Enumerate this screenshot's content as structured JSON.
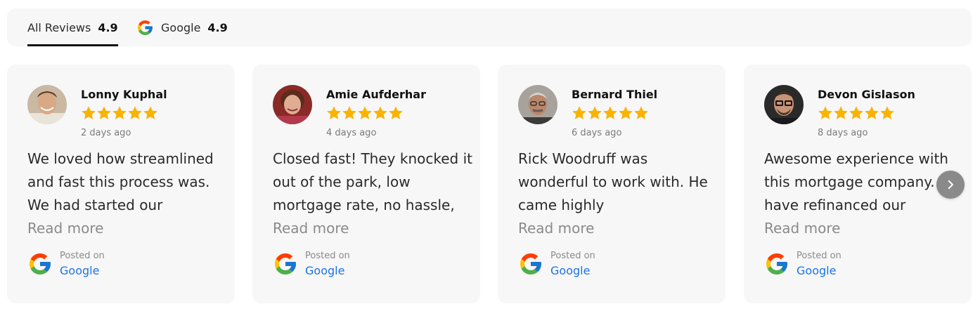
{
  "tabs": [
    {
      "label": "All Reviews",
      "score": "4.9",
      "active": true
    },
    {
      "label": "Google",
      "score": "4.9",
      "icon": "google-icon",
      "active": false
    }
  ],
  "reviews": [
    {
      "name": "Lonny Kuphal",
      "rating": 5,
      "time": "2 days ago",
      "text": "We loved how streamlined and fast this process was. We had started our",
      "read_more": "Read more",
      "posted_on": "Posted on",
      "source": "Google"
    },
    {
      "name": "Amie Aufderhar",
      "rating": 5,
      "time": "4 days ago",
      "text": "Closed fast! They knocked it out of the park, low mortgage rate, no hassle,",
      "read_more": "Read more",
      "posted_on": "Posted on",
      "source": "Google"
    },
    {
      "name": "Bernard Thiel",
      "rating": 5,
      "time": "6 days ago",
      "text": "Rick Woodruff was wonderful to work with. He came highly",
      "read_more": "Read more",
      "posted_on": "Posted on",
      "source": "Google"
    },
    {
      "name": "Devon Gislason",
      "rating": 5,
      "time": "8 days ago",
      "text": "Awesome experience with this mortgage company. We have refinanced our",
      "read_more": "Read more",
      "posted_on": "Posted on",
      "source": "Google"
    }
  ],
  "colors": {
    "star": "#f9b300",
    "link": "#1a73e8",
    "card_bg": "#f7f7f7",
    "next_button": "#8a8a8a"
  },
  "icons": {
    "star": "star-icon",
    "google": "google-icon",
    "next": "chevron-right-icon"
  }
}
